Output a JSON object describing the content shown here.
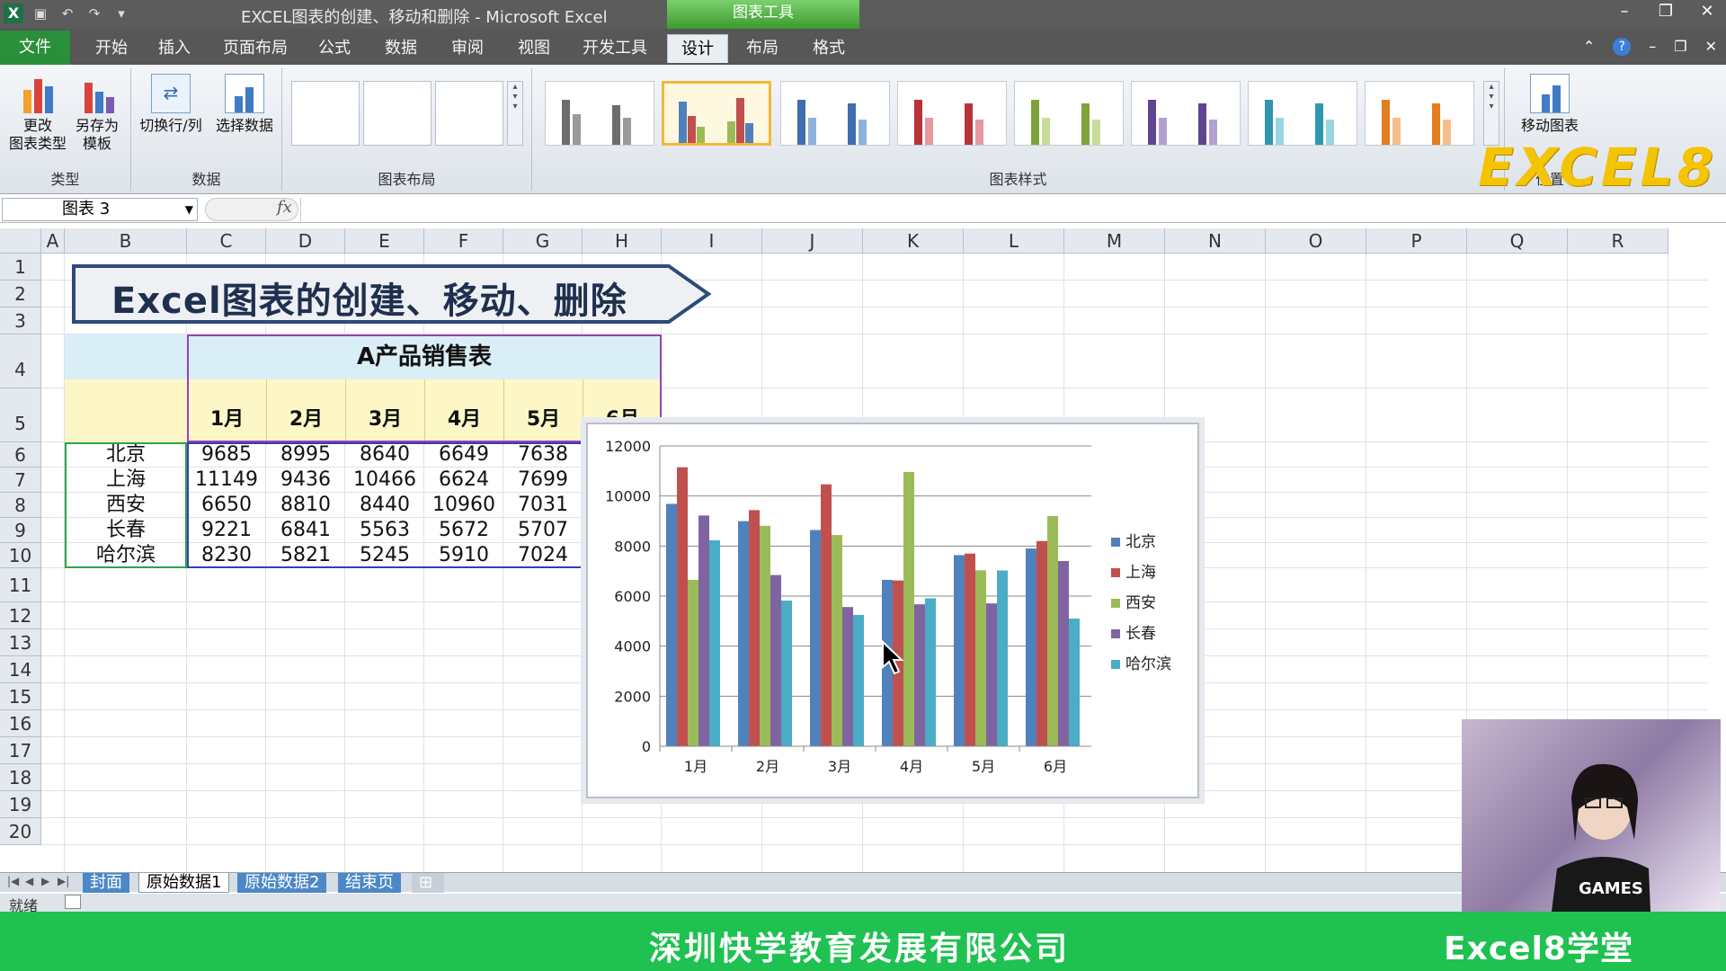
{
  "window": {
    "title": "EXCEL图表的创建、移动和删除 - Microsoft Excel",
    "context_tools": "图表工具"
  },
  "tabs": [
    "文件",
    "开始",
    "插入",
    "页面布局",
    "公式",
    "数据",
    "审阅",
    "视图",
    "开发工具",
    "设计",
    "布局",
    "格式"
  ],
  "active_tab": "设计",
  "ribbon": {
    "type_group": {
      "label": "类型",
      "change_type": "更改\n图表类型",
      "save_template": "另存为\n模板"
    },
    "data_group": {
      "label": "数据",
      "switch_row_col": "切换行/列",
      "select_data": "选择数据"
    },
    "layout_group": {
      "label": "图表布局"
    },
    "style_group": {
      "label": "图表样式"
    },
    "move_chart": "移动图表",
    "location_label": "位置",
    "watermark": "EXCEL8"
  },
  "formula_bar": {
    "name_box": "图表 3",
    "fx": "fx",
    "formula": ""
  },
  "columns": [
    "A",
    "B",
    "C",
    "D",
    "E",
    "F",
    "G",
    "H",
    "I",
    "J",
    "K",
    "L",
    "M",
    "N",
    "O",
    "P",
    "Q",
    "R"
  ],
  "rows": [
    "1",
    "2",
    "3",
    "4",
    "5",
    "6",
    "7",
    "8",
    "9",
    "10",
    "11",
    "12",
    "13",
    "14",
    "15",
    "16",
    "17",
    "18",
    "19",
    "20"
  ],
  "banner_title": "Excel图表的创建、移动、删除",
  "table": {
    "title": "A产品销售表",
    "months": [
      "1月",
      "2月",
      "3月",
      "4月",
      "5月",
      "6月"
    ],
    "rows": [
      {
        "city": "北京",
        "values": [
          "9685",
          "8995",
          "8640",
          "6649",
          "7638"
        ]
      },
      {
        "city": "上海",
        "values": [
          "11149",
          "9436",
          "10466",
          "6624",
          "7699"
        ]
      },
      {
        "city": "西安",
        "values": [
          "6650",
          "8810",
          "8440",
          "10960",
          "7031"
        ]
      },
      {
        "city": "长春",
        "values": [
          "9221",
          "6841",
          "5563",
          "5672",
          "5707"
        ]
      },
      {
        "city": "哈尔滨",
        "values": [
          "8230",
          "5821",
          "5245",
          "5910",
          "7024"
        ]
      }
    ]
  },
  "chart_data": {
    "type": "bar",
    "categories": [
      "1月",
      "2月",
      "3月",
      "4月",
      "5月",
      "6月"
    ],
    "series": [
      {
        "name": "北京",
        "color": "#4f81bd",
        "values": [
          9685,
          8995,
          8640,
          6649,
          7638,
          7900
        ]
      },
      {
        "name": "上海",
        "color": "#c0504d",
        "values": [
          11149,
          9436,
          10466,
          6624,
          7699,
          8200
        ]
      },
      {
        "name": "西安",
        "color": "#9bbb59",
        "values": [
          6650,
          8810,
          8440,
          10960,
          7031,
          9200
        ]
      },
      {
        "name": "长春",
        "color": "#8064a2",
        "values": [
          9221,
          6841,
          5563,
          5672,
          5707,
          7400
        ]
      },
      {
        "name": "哈尔滨",
        "color": "#4bacc6",
        "values": [
          8230,
          5821,
          5245,
          5910,
          7024,
          5100
        ]
      }
    ],
    "yticks": [
      "0",
      "2000",
      "4000",
      "6000",
      "8000",
      "10000",
      "12000"
    ],
    "ylim": [
      0,
      12000
    ],
    "grid": true,
    "legend": "right"
  },
  "sheet_tabs": [
    "封面",
    "原始数据1",
    "原始数据2",
    "结束页"
  ],
  "active_sheet": "原始数据1",
  "status": {
    "ready": "就绪"
  },
  "footer": {
    "company": "深圳快学教育发展有限公司",
    "brand": "Excel8学堂"
  },
  "webcam": {
    "shirt_text": "GAMES"
  }
}
